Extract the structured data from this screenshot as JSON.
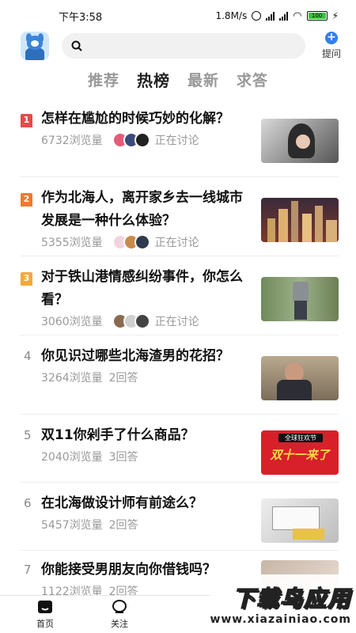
{
  "status_bar": {
    "time": "下午3:58",
    "net_speed": "1.8M/s",
    "battery": "100"
  },
  "header": {
    "search_placeholder": "",
    "ask_label": "提问"
  },
  "tabs": [
    {
      "label": "推荐",
      "active": false
    },
    {
      "label": "热榜",
      "active": true
    },
    {
      "label": "最新",
      "active": false
    },
    {
      "label": "求答",
      "active": false
    }
  ],
  "items": [
    {
      "rank": "1",
      "title": "怎样在尴尬的时候巧妙的化解？",
      "views": "6732浏览量",
      "extra": "正在讨论"
    },
    {
      "rank": "2",
      "title": "作为北海人，离开家乡去一线城市发展是一种什么体验？",
      "views": "5355浏览量",
      "extra": "正在讨论"
    },
    {
      "rank": "3",
      "title": "对于铁山港情感纠纷事件，你怎么看？",
      "views": "3060浏览量",
      "extra": "正在讨论"
    },
    {
      "rank": "4",
      "title": "你见识过哪些北海渣男的花招？",
      "views": "3264浏览量",
      "extra": "2回答"
    },
    {
      "rank": "5",
      "title": "双11你剁手了什么商品？",
      "views": "2040浏览量",
      "extra": "3回答",
      "thumb_text": "双十一来了",
      "thumb_badge": "全球狂欢节"
    },
    {
      "rank": "6",
      "title": "在北海做设计师有前途么？",
      "views": "5457浏览量",
      "extra": "2回答"
    },
    {
      "rank": "7",
      "title": "你能接受男朋友向你借钱吗？",
      "views": "1122浏览量",
      "extra": "2回答"
    }
  ],
  "colors": {
    "rank1": "#e54a4a",
    "rank2": "#f07a2e",
    "rank3": "#f2a93b",
    "accent": "#2f80ed"
  },
  "bottom_nav": [
    {
      "label": "首页",
      "icon": "home-icon"
    },
    {
      "label": "关注",
      "icon": "follow-icon"
    }
  ],
  "watermark": {
    "title": "下载鸟应用",
    "url": "www.xiazainiao.com"
  }
}
